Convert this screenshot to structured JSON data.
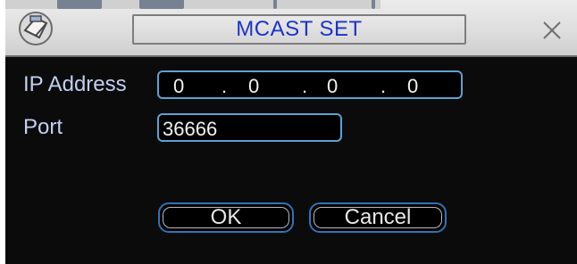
{
  "dialog": {
    "title": "MCAST SET",
    "icons": {
      "app": "camera-icon",
      "close": "close-icon"
    }
  },
  "form": {
    "ip_label": "IP Address",
    "ip_octets": [
      "0",
      ".",
      "0",
      ".",
      "0",
      ".",
      "0"
    ],
    "port_label": "Port",
    "port_value": "36666"
  },
  "buttons": {
    "ok": "OK",
    "cancel": "Cancel"
  },
  "colors": {
    "title_text": "#1b34c8",
    "label_text": "#c2cff0",
    "field_border": "#5da2d6",
    "button_border": "#2e74b8",
    "background": "#0b0b0b"
  }
}
